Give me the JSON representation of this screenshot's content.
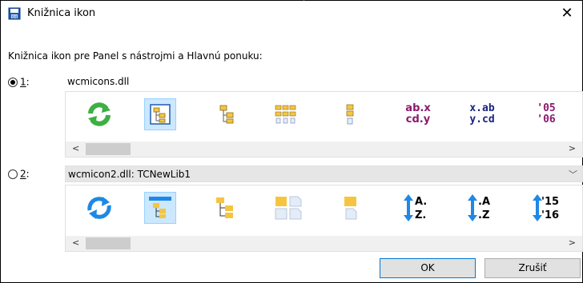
{
  "window": {
    "title": "Knižnica ikon",
    "close_symbol": "✕"
  },
  "description": "Knižnica ikon pre Panel s nástrojmi a Hlavnú ponuku:",
  "library1": {
    "radio_label_prefix": "1",
    "radio_label_suffix": ":",
    "selected": true,
    "name": "wcmicons.dll",
    "icons": [
      "refresh-icon",
      "tree-icon",
      "tree-icon",
      "grid-icon",
      "small-tree-icon",
      "ab-x-icon",
      "x-ab-icon",
      "year-05-06-icon"
    ],
    "text_icons": {
      "abx_top": "ab.x",
      "abx_bottom": "cd.y",
      "xab_top": "x.ab",
      "xab_bottom": "y.cd",
      "year_top": "'05",
      "year_bottom": "'06"
    }
  },
  "library2": {
    "radio_label_prefix": "2",
    "radio_label_suffix": ":",
    "selected": false,
    "name": "wcmicon2.dll: TCNewLib1",
    "icons": [
      "sync-icon",
      "tree-icon",
      "tree-icon",
      "folder-files-icon",
      "folder-file-icon",
      "sort-az-icon",
      "sort-az-dot-icon",
      "sort-15-16-icon"
    ],
    "text_icons": {
      "az_top": "A.",
      "az_bottom": "Z.",
      "az2_top": ".A",
      "az2_bottom": ".Z",
      "num_top": "'15",
      "num_bottom": "'16"
    }
  },
  "scrollbar": {
    "left_arrow": "<",
    "right_arrow": ">"
  },
  "dropdown_chevron": "﹀",
  "buttons": {
    "ok": "OK",
    "cancel": "Zrušiť"
  },
  "colors": {
    "accent": "#0078d7",
    "selection": "#cce8ff",
    "dropdown_bg": "#e6e6e6",
    "purple_text": "#8b1a6b",
    "navy_text": "#1a237e",
    "blue_arrow": "#1e88e5",
    "green": "#3cb043",
    "folder": "#f5c542"
  }
}
